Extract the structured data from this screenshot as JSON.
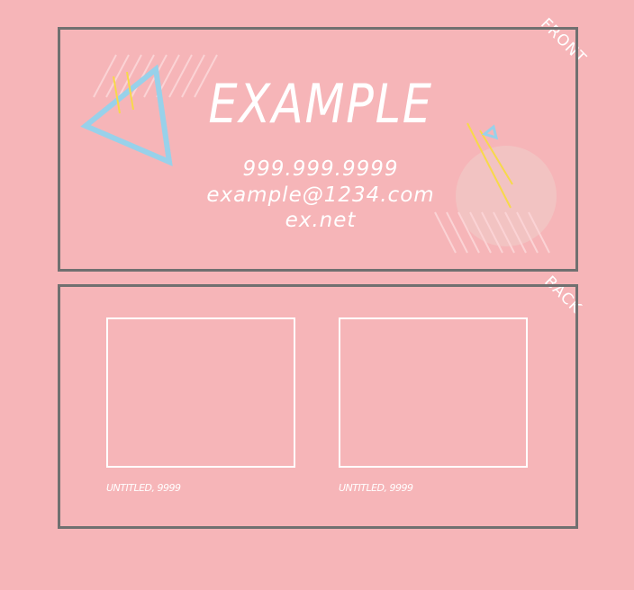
{
  "front": {
    "label": "FRONT",
    "title": "EXAMPLE",
    "phone": "999.999.9999",
    "email": "example@1234.com",
    "website": "ex.net"
  },
  "back": {
    "label": "BACK",
    "items": [
      {
        "caption": "UNTITLED, 9999"
      },
      {
        "caption": "UNTITLED, 9999"
      }
    ]
  },
  "colors": {
    "background": "#f6b5b8",
    "border": "#707070",
    "accent_blue": "#98d1ea",
    "accent_yellow": "#f7d94a",
    "text": "#ffffff"
  }
}
